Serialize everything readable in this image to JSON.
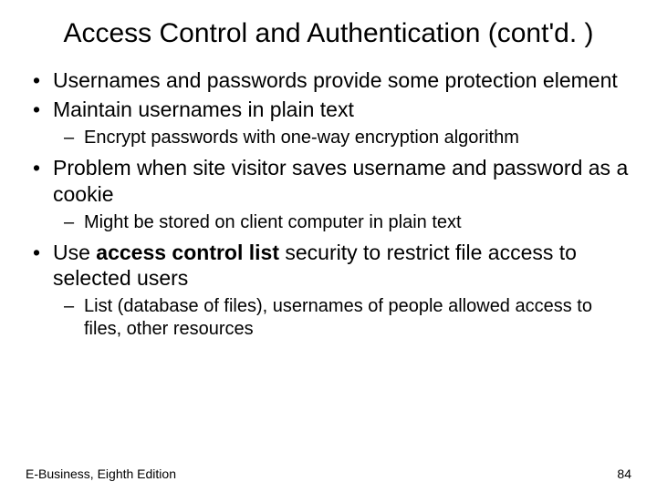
{
  "title": "Access Control and Authentication (cont'd. )",
  "b1": "Usernames and passwords provide some protection element",
  "b2": "Maintain usernames in plain text",
  "b2s1": "Encrypt passwords with one-way encryption algorithm",
  "b3": "Problem when site visitor saves username and password as a cookie",
  "b3s1": "Might be stored on client computer in plain text",
  "b4a": "Use ",
  "b4bold": "access control list",
  "b4b": " security to restrict file access to selected users",
  "b4s1": "List (database of files), usernames of people allowed access to files, other resources",
  "footer_left": "E-Business, Eighth Edition",
  "footer_right": "84"
}
